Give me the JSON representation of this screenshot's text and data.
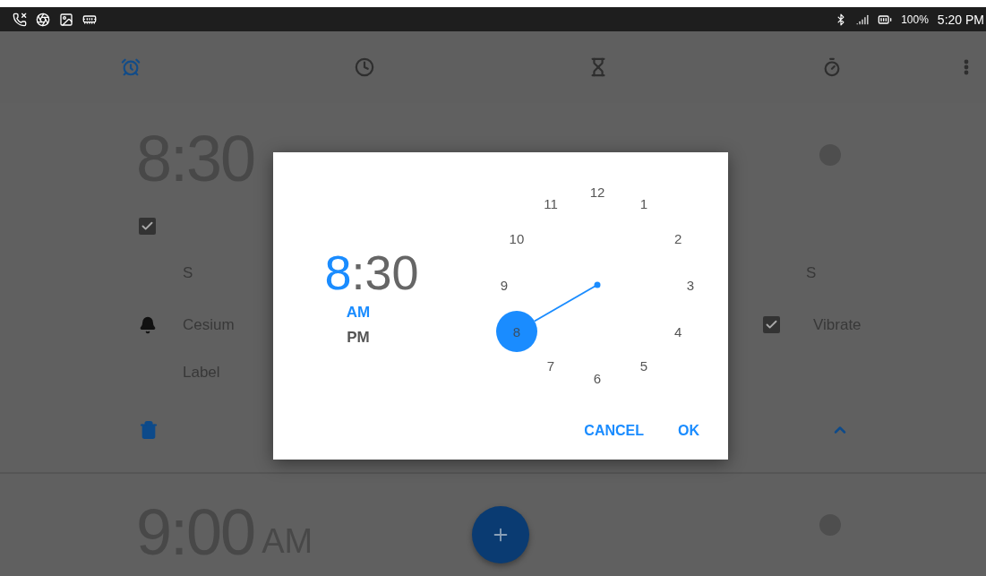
{
  "status_bar": {
    "battery": "100%",
    "time": "5:20 PM"
  },
  "tabs": [
    {
      "kind": "alarm",
      "selected": true
    },
    {
      "kind": "clock",
      "selected": false
    },
    {
      "kind": "timer",
      "selected": false
    },
    {
      "kind": "stopwatch",
      "selected": false
    }
  ],
  "alarms": [
    {
      "time": "8:30",
      "on": false,
      "repeat": {
        "checked": true
      },
      "days": [
        "S",
        "S"
      ],
      "ringtone": "Cesium",
      "vibrate": {
        "label": "Vibrate",
        "checked": true
      },
      "label": "Label"
    },
    {
      "time": "9:00",
      "ampm": "AM",
      "on": false
    }
  ],
  "dialog": {
    "hour": {
      "text": "8",
      "selected": true
    },
    "separator": ":",
    "minute": {
      "text": "30",
      "selected": false
    },
    "periods": [
      {
        "label": "AM",
        "selected": true
      },
      {
        "label": "PM",
        "selected": false
      }
    ],
    "dial": [
      {
        "label": "12",
        "selected": false
      },
      {
        "label": "1",
        "selected": false
      },
      {
        "label": "2",
        "selected": false
      },
      {
        "label": "3",
        "selected": false
      },
      {
        "label": "4",
        "selected": false
      },
      {
        "label": "5",
        "selected": false
      },
      {
        "label": "6",
        "selected": false
      },
      {
        "label": "7",
        "selected": false
      },
      {
        "label": "8",
        "selected": true
      },
      {
        "label": "9",
        "selected": false
      },
      {
        "label": "10",
        "selected": false
      },
      {
        "label": "11",
        "selected": false
      }
    ],
    "buttons": [
      "CANCEL",
      "OK"
    ]
  }
}
